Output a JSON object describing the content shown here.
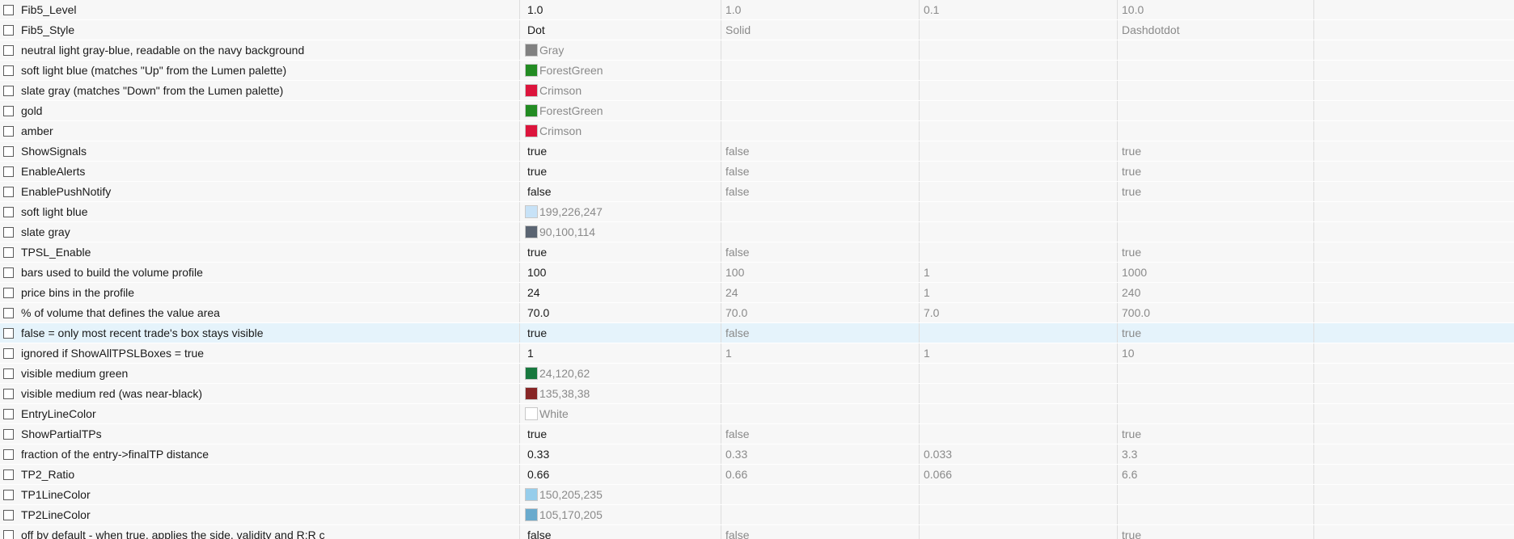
{
  "rows": [
    {
      "name": "Fib5_Level",
      "value": "1.0",
      "start": "1.0",
      "step": "0.1",
      "stop": "10.0"
    },
    {
      "name": "Fib5_Style",
      "value": "Dot",
      "start": "Solid",
      "step": "",
      "stop": "Dashdotdot"
    },
    {
      "name": "neutral light gray-blue, readable on the navy background",
      "color_name": "Gray",
      "color": "#808080",
      "start": "",
      "step": "",
      "stop": ""
    },
    {
      "name": "soft light blue (matches \"Up\" from the Lumen palette)",
      "color_name": "ForestGreen",
      "color": "#228b22",
      "start": "",
      "step": "",
      "stop": ""
    },
    {
      "name": "slate gray (matches \"Down\" from the Lumen palette)",
      "color_name": "Crimson",
      "color": "#dc143c",
      "start": "",
      "step": "",
      "stop": ""
    },
    {
      "name": "gold",
      "color_name": "ForestGreen",
      "color": "#228b22",
      "start": "",
      "step": "",
      "stop": ""
    },
    {
      "name": "amber",
      "color_name": "Crimson",
      "color": "#dc143c",
      "start": "",
      "step": "",
      "stop": ""
    },
    {
      "name": "ShowSignals",
      "value": "true",
      "start": "false",
      "step": "",
      "stop": "true"
    },
    {
      "name": "EnableAlerts",
      "value": "true",
      "start": "false",
      "step": "",
      "stop": "true"
    },
    {
      "name": "EnablePushNotify",
      "value": "false",
      "start": "false",
      "step": "",
      "stop": "true"
    },
    {
      "name": "soft light blue",
      "color_name": "199,226,247",
      "color": "#c7e2f7",
      "start": "",
      "step": "",
      "stop": ""
    },
    {
      "name": "slate gray",
      "color_name": "90,100,114",
      "color": "#5a6472",
      "start": "",
      "step": "",
      "stop": ""
    },
    {
      "name": "TPSL_Enable",
      "value": "true",
      "start": "false",
      "step": "",
      "stop": "true"
    },
    {
      "name": "bars used to build the volume profile",
      "value": "100",
      "start": "100",
      "step": "1",
      "stop": "1000"
    },
    {
      "name": "price bins in the profile",
      "value": "24",
      "start": "24",
      "step": "1",
      "stop": "240"
    },
    {
      "name": "% of volume that defines the value area",
      "value": "70.0",
      "start": "70.0",
      "step": "7.0",
      "stop": "700.0"
    },
    {
      "name": "false = only most recent trade's box stays visible",
      "value": "true",
      "start": "false",
      "step": "",
      "stop": "true",
      "selected": true
    },
    {
      "name": "ignored if ShowAllTPSLBoxes = true",
      "value": "1",
      "start": "1",
      "step": "1",
      "stop": "10"
    },
    {
      "name": "visible medium green",
      "color_name": "24,120,62",
      "color": "#18783e",
      "start": "",
      "step": "",
      "stop": ""
    },
    {
      "name": "visible medium red (was near-black)",
      "color_name": "135,38,38",
      "color": "#872626",
      "start": "",
      "step": "",
      "stop": ""
    },
    {
      "name": "EntryLineColor",
      "color_name": "White",
      "color": "#ffffff",
      "start": "",
      "step": "",
      "stop": ""
    },
    {
      "name": "ShowPartialTPs",
      "value": "true",
      "start": "false",
      "step": "",
      "stop": "true"
    },
    {
      "name": "fraction of the entry->finalTP distance",
      "value": "0.33",
      "start": "0.33",
      "step": "0.033",
      "stop": "3.3"
    },
    {
      "name": "TP2_Ratio",
      "value": "0.66",
      "start": "0.66",
      "step": "0.066",
      "stop": "6.6"
    },
    {
      "name": "TP1LineColor",
      "color_name": "150,205,235",
      "color": "#96cdeb",
      "start": "",
      "step": "",
      "stop": ""
    },
    {
      "name": "TP2LineColor",
      "color_name": "105,170,205",
      "color": "#69aacd",
      "start": "",
      "step": "",
      "stop": ""
    },
    {
      "name": "off by default - when true, applies the side, validity and R:R c",
      "value": "false",
      "start": "false",
      "step": "",
      "stop": "true"
    }
  ]
}
